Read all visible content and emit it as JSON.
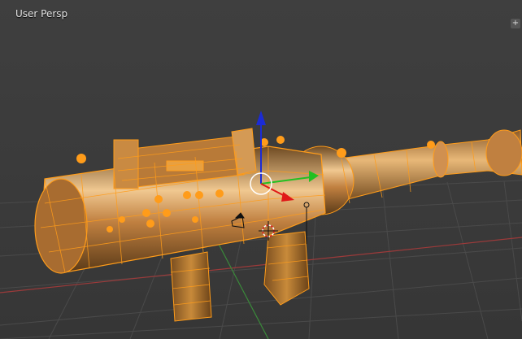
{
  "viewport": {
    "label": "User Persp",
    "corner_button": "+",
    "selection_color": "#ff9c1a",
    "body_color": "#c88a3a",
    "grid_color": "#4a4a4a",
    "x_axis_color": "#9c3a3a",
    "y_axis_color": "#3a8a3a",
    "gizmo_z_color": "#1b2bd6",
    "gizmo_y_color": "#22c022",
    "gizmo_x_color": "#e01818"
  },
  "icons": {
    "manipulator": "transform-manipulator-icon",
    "cursor": "3d-cursor-icon",
    "camera": "camera-icon",
    "lamp": "lamp-icon"
  }
}
